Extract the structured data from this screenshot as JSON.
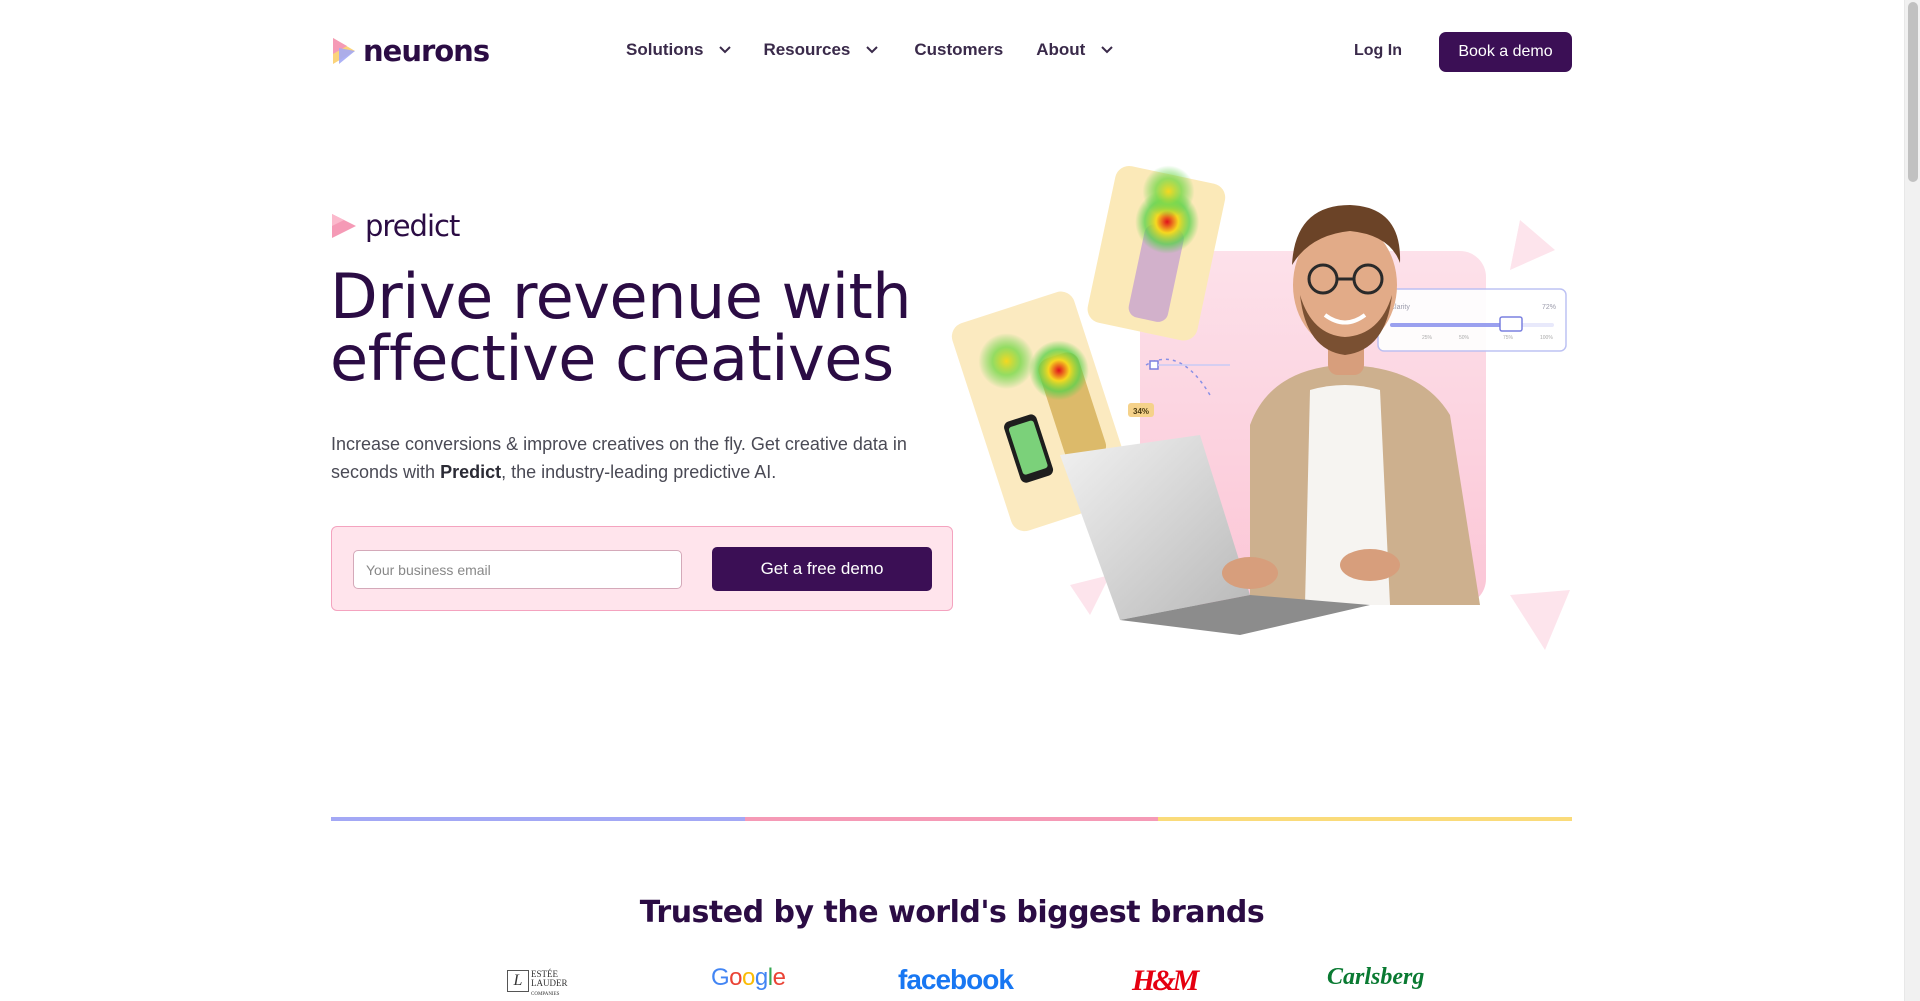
{
  "header": {
    "logo_text": "neurons",
    "nav": {
      "solutions": "Solutions",
      "resources": "Resources",
      "customers": "Customers",
      "about": "About"
    },
    "login": "Log In",
    "book_demo": "Book a demo"
  },
  "hero": {
    "product_name": "predict",
    "headline_line1": "Drive revenue with",
    "headline_line2": "effective creatives",
    "subtext_before": "Increase conversions & improve creatives on the fly. Get creative data in seconds with ",
    "subtext_bold": "Predict",
    "subtext_after": ", the industry-leading predictive AI.",
    "email_placeholder": "Your business email",
    "cta": "Get a free demo",
    "clarity_card": {
      "label": "Clarity",
      "value": "72%",
      "scale": [
        "25%",
        "50%",
        "75%",
        "100%"
      ]
    },
    "ad_percent": "34%"
  },
  "divider_colors": [
    "#a3a8f5",
    "#f59ab6",
    "#fadb7a"
  ],
  "trusted": {
    "title": "Trusted by the world's biggest brands",
    "brands": {
      "estee": [
        "ESTÉE",
        "LAUDER",
        "COMPANIES"
      ],
      "google": "Google",
      "facebook": "facebook",
      "hm": "H&M",
      "carlsberg": "Carlsberg"
    }
  },
  "colors": {
    "brand_purple": "#3b0f55",
    "heading": "#2b0c44",
    "form_bg": "#ffe4ec",
    "form_border": "#f4a3bf"
  }
}
